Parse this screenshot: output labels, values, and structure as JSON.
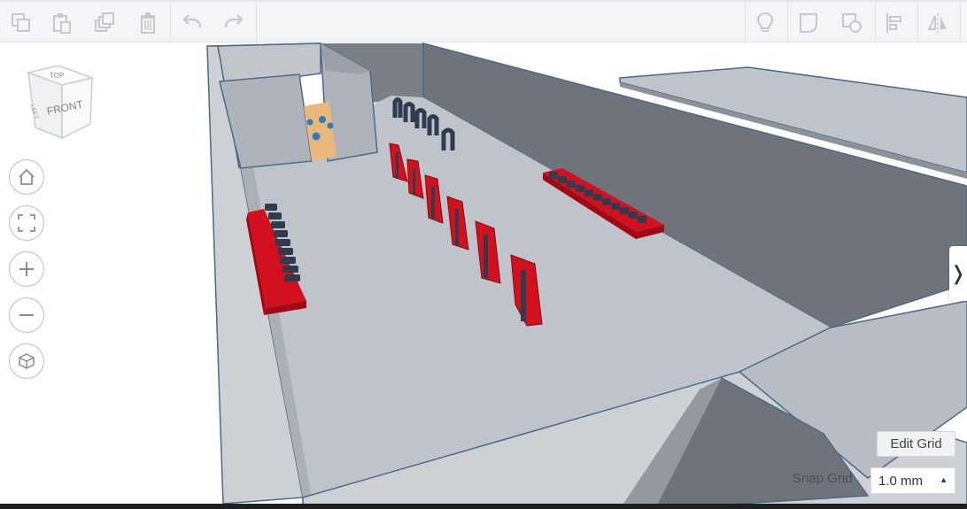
{
  "toolbar": {
    "left_buttons": [
      {
        "name": "copy-icon"
      },
      {
        "name": "paste-icon"
      },
      {
        "name": "duplicate-icon"
      },
      {
        "name": "delete-icon"
      },
      {
        "name": "undo-icon"
      },
      {
        "name": "redo-icon"
      }
    ],
    "right_buttons": [
      {
        "name": "lightbulb-icon"
      },
      {
        "name": "note-icon"
      },
      {
        "name": "ruler-icon"
      },
      {
        "name": "align-icon"
      },
      {
        "name": "mirror-icon"
      }
    ]
  },
  "viewcube": {
    "top_label": "TOP",
    "front_label": "FRONT",
    "side_label": "LEFT"
  },
  "nav": [
    "home-view-icon",
    "fit-view-icon",
    "zoom-in-icon",
    "zoom-out-icon",
    "ortho-view-icon"
  ],
  "grid": {
    "edit_label": "Edit Grid",
    "snap_label": "Snap Grid",
    "snap_value": "1.0 mm"
  },
  "side_panel": {
    "toggle_glyph": "❭"
  },
  "colors": {
    "floor": "#bfc4ca",
    "wall_dark": "#6e7479",
    "wall_light": "#cdd1d5",
    "outline": "#4b6a86",
    "red": "#d2101e",
    "navy": "#2e3c4e",
    "door": "#e8b77a",
    "dots": "#2f79c4"
  }
}
